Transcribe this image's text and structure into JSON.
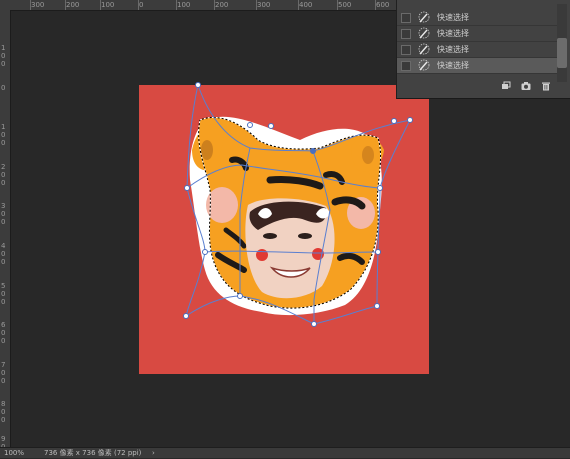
{
  "ruler": {
    "top_labels": [
      "300",
      "200",
      "100",
      "0",
      "100",
      "200",
      "300",
      "400",
      "500",
      "600"
    ],
    "left_labels": [
      "1\n0\n0",
      "0",
      "1\n0\n0",
      "2\n0\n0",
      "3\n0\n0",
      "4\n0\n0",
      "5\n0\n0",
      "6\n0\n0",
      "7\n0\n0",
      "8\n0\n0",
      "9\n0\n0"
    ]
  },
  "layers": {
    "items": [
      {
        "label": "快速选择"
      },
      {
        "label": "快速选择"
      },
      {
        "label": "快速选择"
      },
      {
        "label": "快速选择"
      }
    ],
    "active_index": 3,
    "footer_icons": [
      "new-snapshot-icon",
      "camera-icon",
      "trash-icon"
    ]
  },
  "document": {
    "background_color": "#d84a42",
    "subject": "tiger-hat-portrait"
  },
  "status": {
    "zoom": "100%",
    "info": "736 像素 x 736 像素 (72 ppi)",
    "arrow": "›"
  }
}
